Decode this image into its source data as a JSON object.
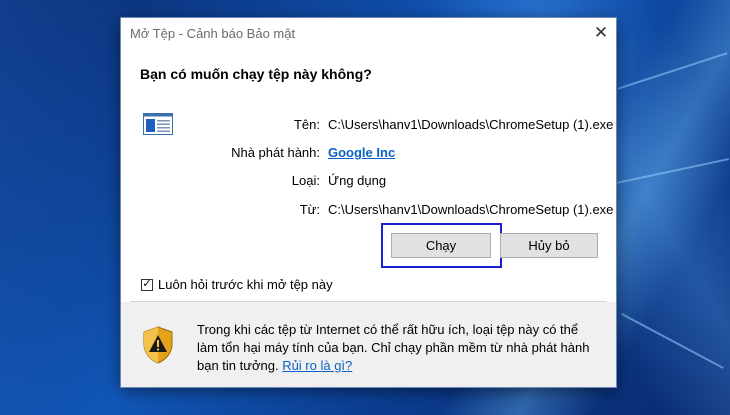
{
  "dialog": {
    "title": "Mở Tệp - Cảnh báo Bảo mật",
    "close_symbol": "✕",
    "question": "Bạn có muốn chạy tệp này không?",
    "file_icon": "exe-file-icon",
    "fields": {
      "name_label": "Tên:",
      "name_value": "C:\\Users\\hanv1\\Downloads\\ChromeSetup (1).exe",
      "publisher_label": "Nhà phát hành:",
      "publisher_value": "Google Inc",
      "type_label": "Loại:",
      "type_value": "Ứng dụng",
      "from_label": "Từ:",
      "from_value": "C:\\Users\\hanv1\\Downloads\\ChromeSetup (1).exe"
    },
    "buttons": {
      "run_label": "Chạy",
      "cancel_label": "Hủy bỏ"
    },
    "checkbox": {
      "checked": true,
      "mark": "✓",
      "label": "Luôn hỏi trước khi mở tệp này"
    },
    "warning": {
      "icon": "security-shield-icon",
      "text": "Trong khi các tệp từ Internet có thể rất hữu ích, loại tệp này có thể làm tổn hại máy tính của bạn. Chỉ chạy phần mềm từ nhà phát hành bạn tin tưởng.",
      "link": "Rủi ro là gì?"
    }
  },
  "colors": {
    "link": "#0b62c4",
    "highlight_border": "#1a1fd0",
    "desktop_bg": "#1157b8"
  }
}
